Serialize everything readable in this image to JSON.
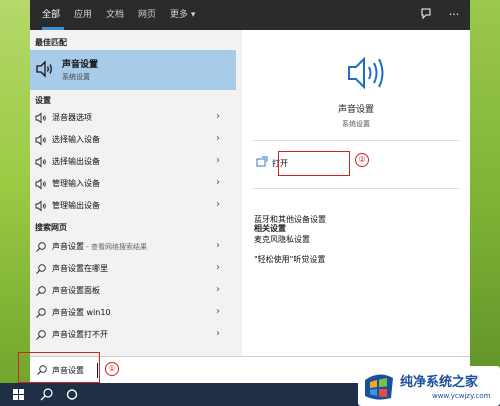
{
  "top_tabs": [
    "全部",
    "应用",
    "文档",
    "网页",
    "更多 ▾"
  ],
  "sections": {
    "best_match": "最佳匹配",
    "settings": "设置",
    "web": "搜索网页"
  },
  "best_match": {
    "icon": "speaker-icon",
    "title": "声音设置",
    "subtitle": "系统设置"
  },
  "settings_items": [
    {
      "label": "混音器选项",
      "icon": "speaker-icon"
    },
    {
      "label": "选择输入设备",
      "icon": "speaker-icon"
    },
    {
      "label": "选择输出设备",
      "icon": "speaker-icon"
    },
    {
      "label": "管理输入设备",
      "icon": "speaker-icon"
    },
    {
      "label": "管理输出设备",
      "icon": "speaker-icon"
    }
  ],
  "web_items": [
    {
      "label": "声音设置",
      "hint": " - 查看网络搜索结果",
      "icon": "search-icon"
    },
    {
      "label": "声音设置在哪里",
      "hint": "",
      "icon": "search-icon"
    },
    {
      "label": "声音设置面板",
      "hint": "",
      "icon": "search-icon"
    },
    {
      "label": "声音设置 win10",
      "hint": "",
      "icon": "search-icon"
    },
    {
      "label": "声音设置打不开",
      "hint": "",
      "icon": "search-icon"
    }
  ],
  "preview": {
    "title": "声音设置",
    "subtitle": "系统设置",
    "open_label": "打开",
    "related_heading": "相关设置",
    "related_links": [
      "蓝牙和其他设备设置",
      "麦克风隐私设置",
      "\"轻松使用\"听觉设置"
    ]
  },
  "search": {
    "value": "声音设置"
  },
  "annotations": {
    "step1": "①",
    "step2": "②"
  },
  "watermark": {
    "title": "纯净系统之家",
    "url": "www.ycwjzy.com"
  },
  "colors": {
    "accent": "#3b8fd8",
    "highlight": "#a8cbe9",
    "annotation": "#d42121",
    "taskbar": "#1f2f45"
  }
}
